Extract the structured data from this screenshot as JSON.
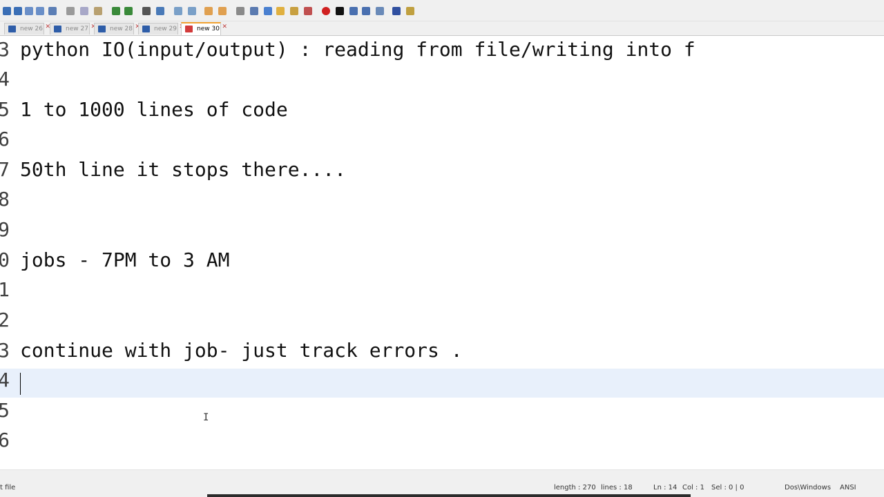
{
  "tabs": [
    {
      "label": "new 26"
    },
    {
      "label": "new 27"
    },
    {
      "label": "new 28"
    },
    {
      "label": "new 29"
    },
    {
      "label": "new 30",
      "active": true
    }
  ],
  "editor": {
    "lines": [
      {
        "num": "3",
        "text": "python IO(input/output) : reading from file/writing into f"
      },
      {
        "num": "4",
        "text": ""
      },
      {
        "num": "5",
        "text": "1 to 1000 lines of code"
      },
      {
        "num": "6",
        "text": ""
      },
      {
        "num": "7",
        "text": "50th line it stops there...."
      },
      {
        "num": "8",
        "text": ""
      },
      {
        "num": "9",
        "text": ""
      },
      {
        "num": "0",
        "text": "jobs - 7PM to 3 AM"
      },
      {
        "num": "1",
        "text": ""
      },
      {
        "num": "2",
        "text": ""
      },
      {
        "num": "3",
        "text": "continue with job- just track errors ."
      },
      {
        "num": "4",
        "text": ""
      },
      {
        "num": "5",
        "text": ""
      },
      {
        "num": "6",
        "text": ""
      }
    ],
    "ibeam_glyph": "I"
  },
  "status": {
    "file_type": "t file",
    "length": "length : 270",
    "lines": "lines : 18",
    "ln": "Ln : 14",
    "col": "Col : 1",
    "sel": "Sel : 0 | 0",
    "eol": "Dos\\Windows",
    "encoding": "ANSI"
  },
  "colors": {
    "current_line": "#e8f0fb",
    "active_tab_accent": "#f0a030"
  }
}
